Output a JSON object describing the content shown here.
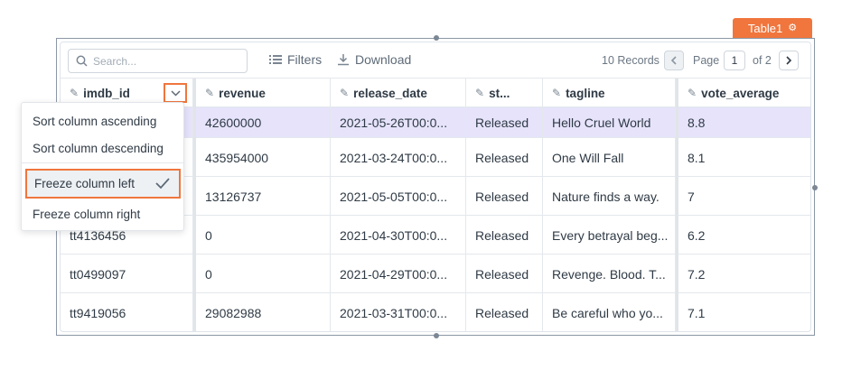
{
  "widget": {
    "name": "Table1",
    "accent": "#f0763d"
  },
  "toolbar": {
    "search_placeholder": "Search...",
    "filters_label": "Filters",
    "download_label": "Download",
    "records_text": "10 Records",
    "page_label": "Page",
    "page_current": "1",
    "page_of": "of 2"
  },
  "columns": [
    "imdb_id",
    "revenue",
    "release_date",
    "st...",
    "tagline",
    "vote_average"
  ],
  "rows": [
    [
      "",
      "42600000",
      "2021-05-26T00:0...",
      "Released",
      "Hello Cruel World",
      "8.8"
    ],
    [
      "",
      "435954000",
      "2021-03-24T00:0...",
      "Released",
      "One Will Fall",
      "8.1"
    ],
    [
      "",
      "13126737",
      "2021-05-05T00:0...",
      "Released",
      "Nature finds a way.",
      "7"
    ],
    [
      "tt4136456",
      "0",
      "2021-04-30T00:0...",
      "Released",
      "Every betrayal beg...",
      "6.2"
    ],
    [
      "tt0499097",
      "0",
      "2021-04-29T00:0...",
      "Released",
      "Revenge. Blood. T...",
      "7.2"
    ],
    [
      "tt9419056",
      "29082988",
      "2021-03-31T00:0...",
      "Released",
      "Be careful who yo...",
      "7.1"
    ]
  ],
  "column_menu": {
    "items": [
      "Sort column ascending",
      "Sort column descending",
      "Freeze column left",
      "Freeze column right"
    ],
    "checked_item": "Freeze column left"
  },
  "colors": {
    "selected_row": "#e6e3fb",
    "highlight": "#f0763d"
  }
}
